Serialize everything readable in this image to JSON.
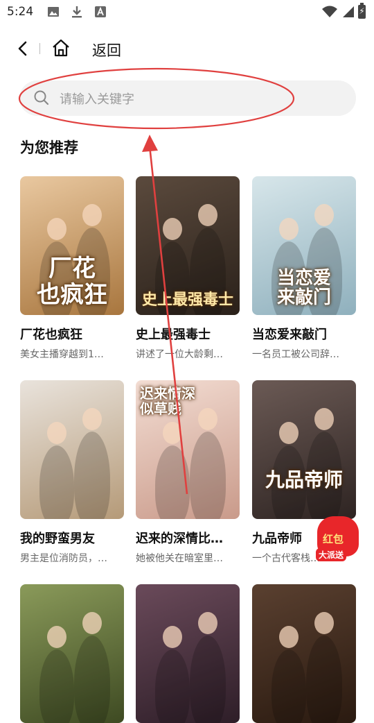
{
  "status_bar": {
    "time": "5:24"
  },
  "nav": {
    "back_label": "返回"
  },
  "search": {
    "placeholder": "请输入关键字"
  },
  "section": {
    "title": "为您推荐"
  },
  "dramas": [
    {
      "title": "厂花也疯狂",
      "desc": "美女主播穿越到1…",
      "cover_text": "厂花\n也疯狂",
      "colors": [
        "#e9c8a0",
        "#a8763e"
      ]
    },
    {
      "title": "史上最强毒士",
      "desc": "讲述了一位大龄剩…",
      "cover_text": "史上最强毒士",
      "colors": [
        "#5b4a3d",
        "#2a211a"
      ]
    },
    {
      "title": "当恋爱来敲门",
      "desc": "一名员工被公司辞…",
      "cover_text": "当恋爱\n来敲门",
      "colors": [
        "#d7e6ea",
        "#8fb0bd"
      ]
    },
    {
      "title": "我的野蛮男友",
      "desc": "男主是位消防员，…",
      "cover_text": "",
      "colors": [
        "#e9e3dc",
        "#b59a78"
      ]
    },
    {
      "title": "迟来的深情比…",
      "desc": "她被他关在暗室里…",
      "cover_text": "迟来情深\n似草贱",
      "colors": [
        "#f3ddd3",
        "#c99a8a"
      ]
    },
    {
      "title": "九品帝师",
      "desc": "一个古代客栈…",
      "cover_text": "九品帝师",
      "colors": [
        "#6b5a55",
        "#2e2422"
      ]
    },
    {
      "title": "",
      "desc": "",
      "cover_text": "",
      "colors": [
        "#8a9a5a",
        "#3e4a22"
      ]
    },
    {
      "title": "",
      "desc": "",
      "cover_text": "",
      "colors": [
        "#6a4a5a",
        "#2e1e28"
      ]
    },
    {
      "title": "",
      "desc": "",
      "cover_text": "",
      "colors": [
        "#5a4030",
        "#2a1a10"
      ]
    }
  ],
  "promo": {
    "line1": "红包",
    "line2": "大派送"
  },
  "annotation": {
    "color": "#e0403f"
  }
}
